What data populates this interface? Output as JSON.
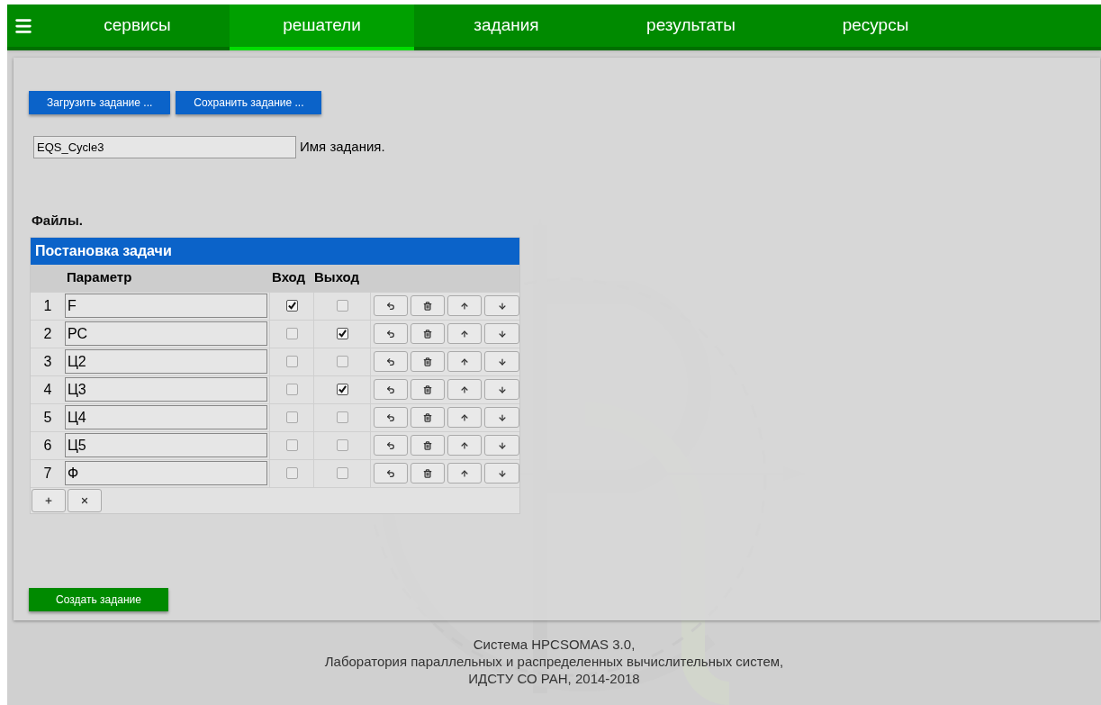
{
  "nav": {
    "items": [
      {
        "label": "сервисы",
        "selected": false
      },
      {
        "label": "решатели",
        "selected": true
      },
      {
        "label": "задания",
        "selected": false
      },
      {
        "label": "результаты",
        "selected": false
      },
      {
        "label": "ресурсы",
        "selected": false
      }
    ]
  },
  "toolbar": {
    "buttons": [
      "Загрузить задание ...",
      "Сохранить задание ..."
    ]
  },
  "task_name": {
    "value": "EQS_Cycle3",
    "label": "Имя задания."
  },
  "files_label": "Файлы.",
  "table": {
    "title": "Постановка задачи",
    "columns": [
      "Параметр",
      "Вход",
      "Выход"
    ],
    "rows": [
      {
        "number": "1",
        "parameter": "F",
        "input": true,
        "output": false
      },
      {
        "number": "2",
        "parameter": "PC",
        "input": false,
        "output": true
      },
      {
        "number": "3",
        "parameter": "Ц2",
        "input": false,
        "output": false
      },
      {
        "number": "4",
        "parameter": "Ц3",
        "input": false,
        "output": true
      },
      {
        "number": "5",
        "parameter": "Ц4",
        "input": false,
        "output": false
      },
      {
        "number": "6",
        "parameter": "Ц5",
        "input": false,
        "output": false
      },
      {
        "number": "7",
        "parameter": "Ф",
        "input": false,
        "output": false
      }
    ]
  },
  "create_button": "Создать задание",
  "footer": [
    "Система HPCSOMAS 3.0,",
    "Лаборатория параллельных и распределенных вычислительных систем,",
    "ИДСТУ СО РАН, 2014-2018"
  ]
}
